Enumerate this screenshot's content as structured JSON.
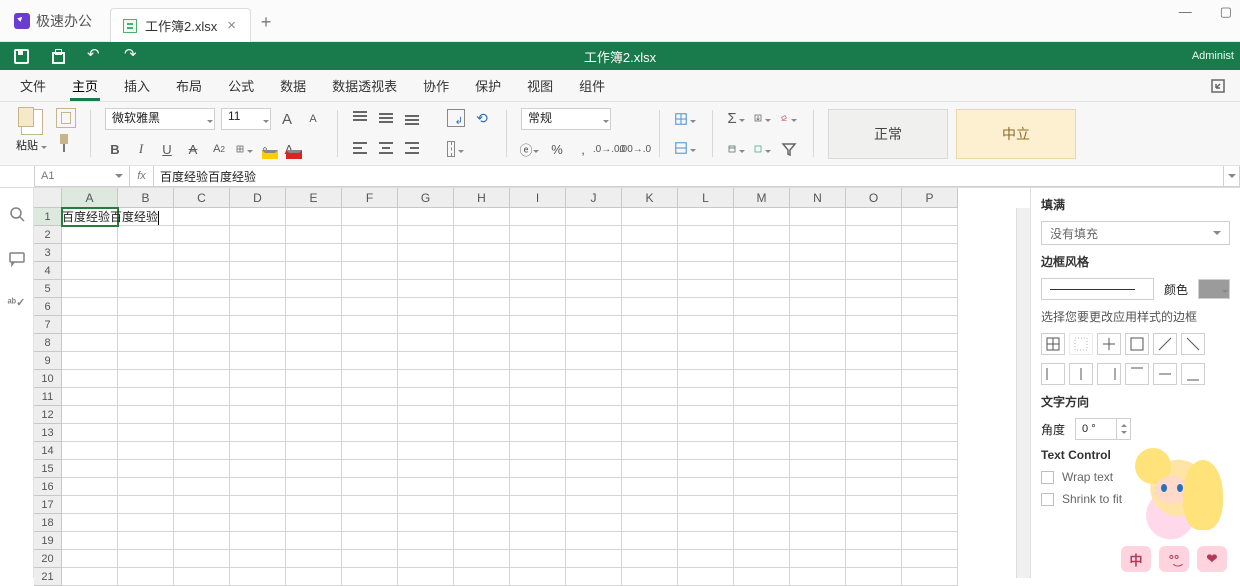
{
  "app": {
    "brand": "极速办公"
  },
  "window": {
    "minimize": "—",
    "maximize": "▢",
    "close": ""
  },
  "doc_tab": {
    "label": "工作簿2.xlsx",
    "close": "×"
  },
  "new_tab": {
    "plus": "+"
  },
  "quick": {
    "doc_name": "工作簿2.xlsx",
    "user": "Administ"
  },
  "menu": {
    "items": [
      "文件",
      "主页",
      "插入",
      "布局",
      "公式",
      "数据",
      "数据透视表",
      "协作",
      "保护",
      "视图",
      "组件"
    ],
    "active_index": 1
  },
  "ribbon": {
    "paste_label": "粘贴",
    "font_name": "微软雅黑",
    "font_size": "11",
    "bigA": "A",
    "smA": "A",
    "bold": "B",
    "italic": "I",
    "underline": "U",
    "strike": "A",
    "super": "A₂",
    "fontcolor": "A",
    "num_format": "常规",
    "style_normal": "正常",
    "style_neutral": "中立"
  },
  "cellref": {
    "name": "A1",
    "fx": "fx",
    "formula": "百度经验百度经验"
  },
  "sheet": {
    "columns": [
      "A",
      "B",
      "C",
      "D",
      "E",
      "F",
      "G",
      "H",
      "I",
      "J",
      "K",
      "L",
      "M",
      "N",
      "O",
      "P"
    ],
    "rows": [
      "1",
      "2",
      "3",
      "4",
      "5",
      "6",
      "7",
      "8",
      "9",
      "10",
      "11",
      "12",
      "13",
      "14",
      "15",
      "16",
      "17",
      "18",
      "19",
      "20",
      "21"
    ],
    "active": {
      "col": 0,
      "row": 0
    },
    "cells": {
      "A1": "百度经验百度经验"
    }
  },
  "panel": {
    "fill_title": "填满",
    "fill_select": "没有填充",
    "border_title": "边框风格",
    "color_label": "颜色",
    "apply_note": "选择您要更改应用样式的边框",
    "text_dir_title": "文字方向",
    "angle_label": "角度",
    "angle_value": "0 °",
    "text_control_title": "Text Control",
    "wrap_label": "Wrap text",
    "shrink_label": "Shrink to fit"
  },
  "mascot": {
    "b1": "中",
    "b2": "°͜°",
    "b3": "❤"
  }
}
